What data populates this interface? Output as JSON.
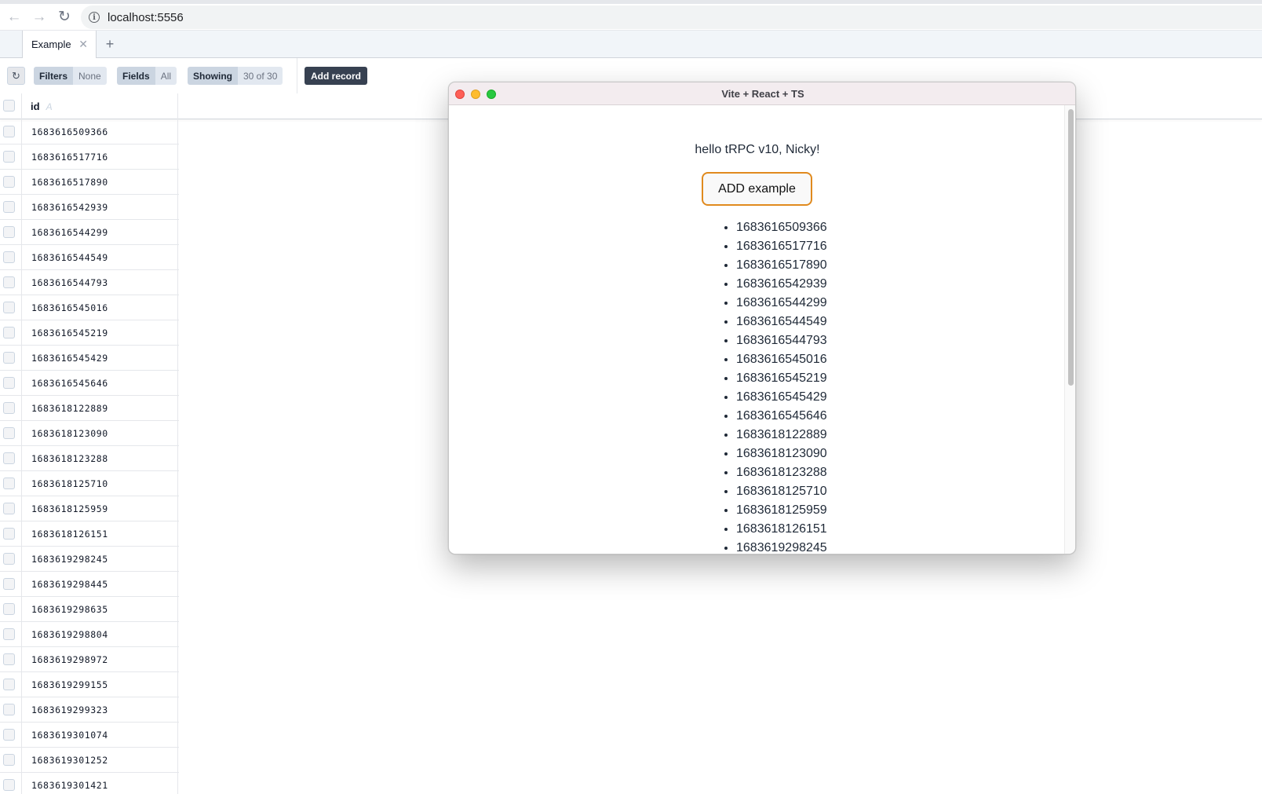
{
  "browser": {
    "url": "localhost:5556"
  },
  "tabs": [
    {
      "label": "Example"
    }
  ],
  "toolbar": {
    "filters_label": "Filters",
    "filters_value": "None",
    "fields_label": "Fields",
    "fields_value": "All",
    "showing_label": "Showing",
    "showing_value": "30 of 30",
    "add_record_label": "Add record"
  },
  "table": {
    "column_header": "id",
    "column_type": "A",
    "rows": [
      "1683616509366",
      "1683616517716",
      "1683616517890",
      "1683616542939",
      "1683616544299",
      "1683616544549",
      "1683616544793",
      "1683616545016",
      "1683616545219",
      "1683616545429",
      "1683616545646",
      "1683618122889",
      "1683618123090",
      "1683618123288",
      "1683618125710",
      "1683618125959",
      "1683618126151",
      "1683619298245",
      "1683619298445",
      "1683619298635",
      "1683619298804",
      "1683619298972",
      "1683619299155",
      "1683619299323",
      "1683619301074",
      "1683619301252",
      "1683619301421"
    ]
  },
  "popup": {
    "title": "Vite + React + TS",
    "greeting": "hello tRPC v10, Nicky!",
    "button_label": "ADD example",
    "items": [
      "1683616509366",
      "1683616517716",
      "1683616517890",
      "1683616542939",
      "1683616544299",
      "1683616544549",
      "1683616544793",
      "1683616545016",
      "1683616545219",
      "1683616545429",
      "1683616545646",
      "1683618122889",
      "1683618123090",
      "1683618123288",
      "1683618125710",
      "1683618125959",
      "1683618126151",
      "1683619298245"
    ]
  },
  "colors": {
    "button_border": "#e08a1e",
    "add_record_bg": "#374151",
    "close": "#fe5f57",
    "minimize": "#febc2e",
    "maximize": "#28c840"
  },
  "icons": {
    "back": "arrow-left-icon",
    "forward": "arrow-right-icon",
    "reload": "reload-icon",
    "info": "info-icon",
    "tab_close": "close-icon",
    "tab_add": "plus-icon",
    "refresh": "refresh-icon"
  }
}
